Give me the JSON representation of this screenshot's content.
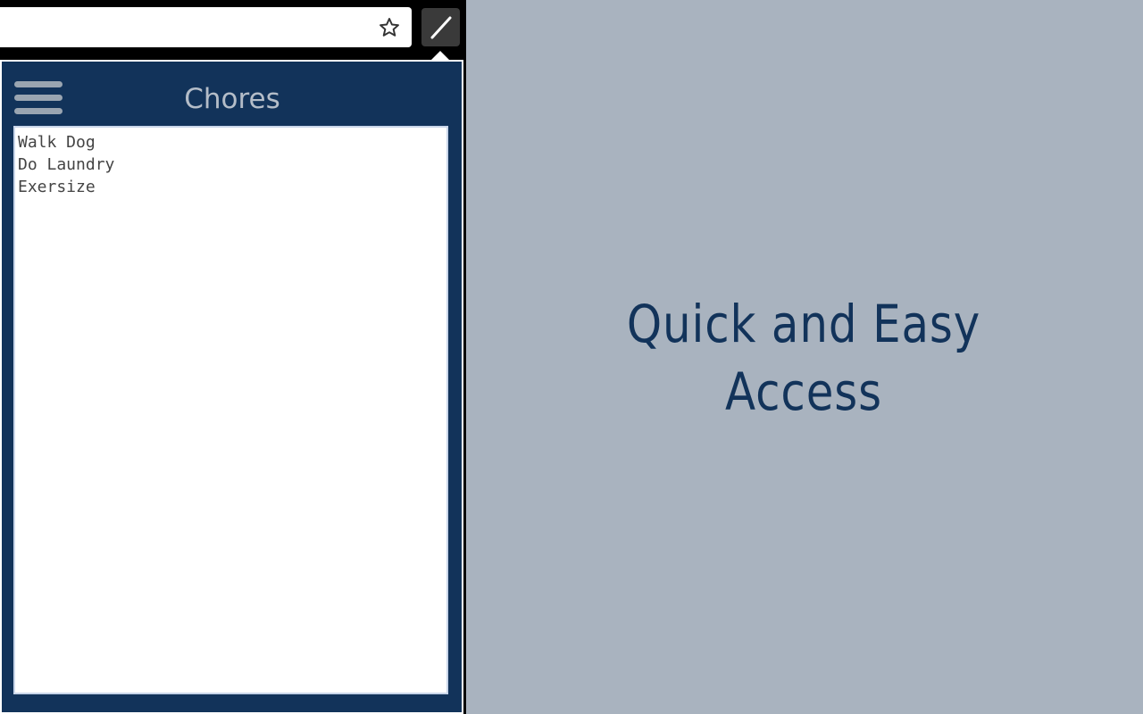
{
  "browser": {
    "bookmark_icon": "star-outline-icon",
    "extension_icon": "pencil-icon"
  },
  "popup": {
    "menu_icon": "hamburger-menu-icon",
    "title": "Chores",
    "note_text": "Walk Dog\nDo Laundry\nExersize"
  },
  "promo": {
    "tagline": "Quick and Easy\nAccess"
  },
  "colors": {
    "popup_background": "#12335a",
    "page_background": "#a9b3bf",
    "tagline": "#12335a",
    "menu_icon": "#9aa5b1"
  }
}
